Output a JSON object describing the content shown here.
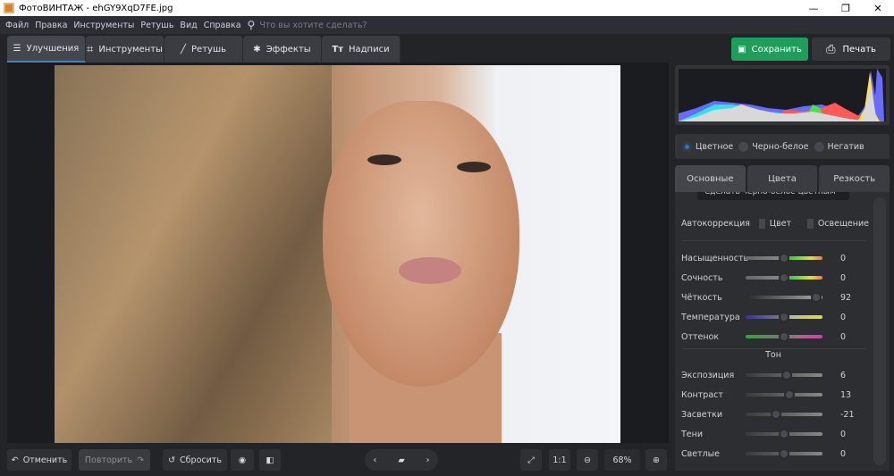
{
  "window": {
    "title": "ФотоВИНТАЖ - ehGY9XqD7FE.jpg",
    "minimize": "—",
    "maximize": "❐",
    "close": "✕"
  },
  "menu": {
    "items": [
      "Файл",
      "Правка",
      "Инструменты",
      "Ретушь",
      "Вид",
      "Справка"
    ],
    "search_placeholder": "Что вы хотите сделать?"
  },
  "tabs": [
    {
      "label": "Улучшения",
      "icon": "sliders-icon"
    },
    {
      "label": "Инструменты",
      "icon": "crop-icon"
    },
    {
      "label": "Ретушь",
      "icon": "brush-icon"
    },
    {
      "label": "Эффекты",
      "icon": "magic-wand-icon"
    },
    {
      "label": "Надписи",
      "icon": "text-icon",
      "glyph": "Tт"
    }
  ],
  "actions": {
    "save": "Сохранить",
    "print": "Печать"
  },
  "modes": {
    "items": [
      "Цветное",
      "Черно-белое",
      "Негатив"
    ],
    "selected": "Цветное"
  },
  "settings_tabs": [
    "Основные",
    "Цвета",
    "Резкость"
  ],
  "bw_button": "Сделать черно-белое цветным",
  "autocorrect": {
    "label": "Автокоррекция",
    "color": "Цвет",
    "light": "Освещение"
  },
  "sliders": [
    {
      "label": "Насыщенность",
      "value": 0,
      "min": -100,
      "max": 100
    },
    {
      "label": "Сочность",
      "value": 0,
      "min": -100,
      "max": 100
    },
    {
      "label": "Чёткость",
      "value": 92,
      "min": 0,
      "max": 100
    },
    {
      "label": "Температура",
      "value": 0,
      "min": -100,
      "max": 100
    },
    {
      "label": "Оттенок",
      "value": 0,
      "min": -100,
      "max": 100
    }
  ],
  "tone_heading": "Тон",
  "tone_sliders": [
    {
      "label": "Экспозиция",
      "value": 6,
      "min": -100,
      "max": 100
    },
    {
      "label": "Контраст",
      "value": 13,
      "min": -100,
      "max": 100
    },
    {
      "label": "Засветки",
      "value": -21,
      "min": -100,
      "max": 100
    },
    {
      "label": "Тени",
      "value": 0,
      "min": -100,
      "max": 100
    },
    {
      "label": "Светлые",
      "value": 0,
      "min": -100,
      "max": 100
    }
  ],
  "bottom": {
    "undo": "Отменить",
    "redo": "Повторить",
    "reset": "Сбросить",
    "one_to_one": "1:1",
    "zoom": "68%"
  },
  "colors": {
    "accent": "#1f78d1",
    "save": "#1f9e5a"
  }
}
